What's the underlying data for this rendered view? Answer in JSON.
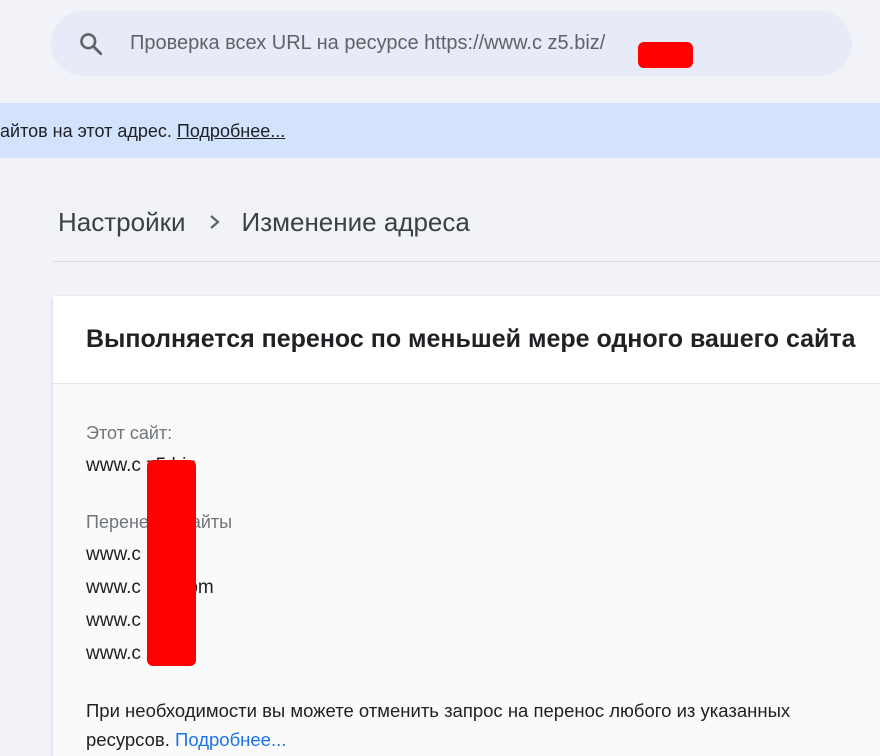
{
  "search": {
    "text": "Проверка всех URL на ресурсе https://www.c      z5.biz/"
  },
  "banner": {
    "text": "айтов на этот адрес.",
    "link": "Подробнее..."
  },
  "breadcrumb": {
    "parent": "Настройки",
    "current": "Изменение адреса"
  },
  "card": {
    "title": "Выполняется перенос по меньшей мере одного вашего сайта",
    "this_site_label": "Этот сайт:",
    "this_site_value": "www.c      z5.biz",
    "moved_label": "Перене      ые сайты",
    "moved_sites": [
      "www.c      z.biz",
      "www.c      zru.com",
      "www.c      z.ru",
      "www.c      z.su"
    ],
    "note_text": "При необходимости вы можете отменить запрос на перенос любого из указанных ресурсов.",
    "note_link": "Подробнее..."
  },
  "colors": {
    "background": "#f1f3f9",
    "search_bg": "#e6ebf7",
    "banner_bg": "#d3e2fd",
    "link": "#1a73e8",
    "redaction": "#ff0000"
  }
}
